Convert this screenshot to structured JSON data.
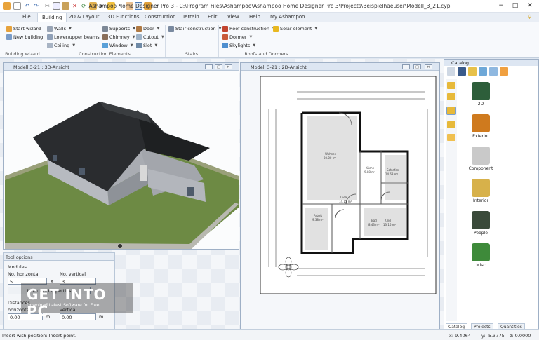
{
  "titlebar": {
    "title": "Ashampoo Home Designer Pro 3 - C:\\Program Files\\Ashampoo\\Ashampoo Home Designer Pro 3\\Projects\\Beispielhaeuser\\Modell_3_21.cyp",
    "minimize": "−",
    "maximize": "□",
    "close": "✕"
  },
  "menu": {
    "items": [
      "File",
      "Building",
      "2D & Layout",
      "3D Functions",
      "Construction",
      "Terrain",
      "Edit",
      "View",
      "Help",
      "My Ashampoo"
    ],
    "active": "Building"
  },
  "ribbon": {
    "wizard": {
      "start": "Start wizard",
      "new_building": "New building",
      "group": "Building wizard"
    },
    "construction": {
      "walls": "Walls",
      "lower_upper_beams": "Lower/upper beams",
      "ceiling": "Ceiling",
      "supports": "Supports",
      "chimney": "Chimney",
      "window": "Window",
      "door": "Door",
      "cutout": "Cutout",
      "slot": "Slot",
      "group": "Construction Elements"
    },
    "stairs": {
      "stair_construction": "Stair construction",
      "group": "Stairs"
    },
    "roofs": {
      "roof_construction": "Roof construction",
      "solar_element": "Solar element",
      "dormer": "Dormer",
      "skylights": "Skylights",
      "group": "Roofs and Dormers"
    }
  },
  "view3d": {
    "title": "Modell 3-21 : 3D-Ansicht"
  },
  "view2d": {
    "title": "Modell 3-21 : 2D-Ansicht",
    "rooms": [
      {
        "name": "Wohnen",
        "area": "30.00 m²"
      },
      {
        "name": "Küche",
        "area": "9.88 m²"
      },
      {
        "name": "Schlafen",
        "area": "14.68 m²"
      },
      {
        "name": "Diele",
        "area": "14.15 m²"
      },
      {
        "name": "Arbeit",
        "area": "9.38 m²"
      },
      {
        "name": "Bad",
        "area": "8.43 m²"
      },
      {
        "name": "Kind",
        "area": "13.16 m²"
      }
    ]
  },
  "tool_options": {
    "title": "Tool options",
    "modules": "Modules",
    "no_horizontal_label": "No. horizontal",
    "no_vertical_label": "No. vertical",
    "no_horizontal": "5",
    "times": "x",
    "no_vertical": "3",
    "module_properties": "Module - Properties",
    "distances": "Distances",
    "horizontal_label": "horizontal",
    "vertical_label": "vertical",
    "horizontal": "0.00",
    "vertical": "0.00",
    "unit_h": "m",
    "unit_v": "m"
  },
  "catalog": {
    "title": "Catalog",
    "items": [
      {
        "label": "2D",
        "color": "#2d5e3a"
      },
      {
        "label": "Exterior",
        "color": "#cf7a1e"
      },
      {
        "label": "Component",
        "color": "#c9c9c9"
      },
      {
        "label": "Interior",
        "color": "#d7b14a"
      },
      {
        "label": "People",
        "color": "#3a4a3a"
      },
      {
        "label": "Misc",
        "color": "#3e8a3a"
      }
    ],
    "tabs": [
      "Catalog",
      "Projects",
      "Quantities"
    ]
  },
  "statusbar": {
    "text": "Insert with position: Insert point.",
    "x": "x: 9.4064",
    "y": "y: -5.3775",
    "z": "z: 0.0000"
  },
  "watermark": {
    "line1": "GET INTO PC",
    "line2": "Download Latest Software for Free"
  }
}
